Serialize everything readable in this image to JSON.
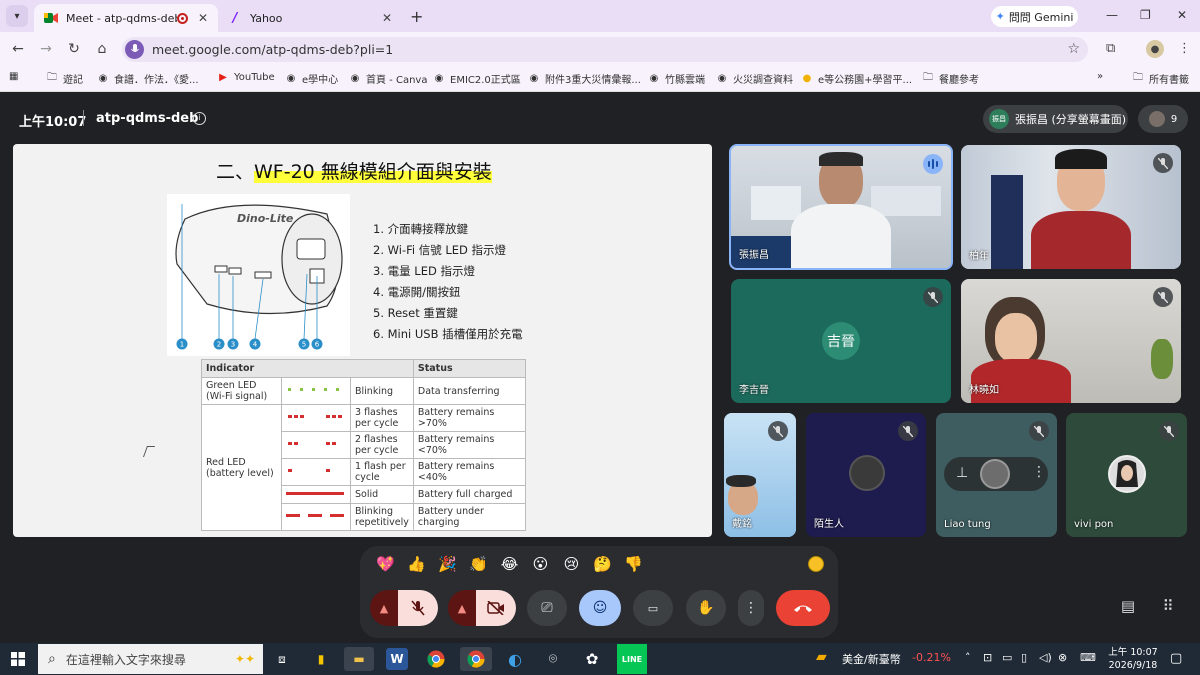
{
  "browser": {
    "tabs": [
      {
        "title": "Meet - atp-qdms-deb",
        "active": true
      },
      {
        "title": "Yahoo",
        "active": false
      }
    ],
    "gemini_label": "問問 Gemini",
    "url": "meet.google.com/atp-qdms-deb?pli=1",
    "bookmarks": [
      "遊記",
      "食譜．作法．《愛...",
      "YouTube",
      "e學中心",
      "首頁 - Canva",
      "EMIC2.0正式區",
      "附件3重大災情彙報...",
      "竹縣雲端",
      "火災調查資料",
      "e等公務園+學習平...",
      "餐廳參考"
    ],
    "all_bookmarks": "所有書籤"
  },
  "meet": {
    "time": "上午10:07",
    "meeting_code": "atp-qdms-deb",
    "presenter_chip": "張振昌 (分享螢幕畫面)",
    "presenter_initials": "振昌",
    "participant_count": "9",
    "slide": {
      "title_prefix": "二、",
      "title_highlight": "WF-20 無線模組介面與安裝",
      "device_brand": "Dino-Lite",
      "callouts": [
        "1",
        "2",
        "3",
        "4",
        "5",
        "6"
      ],
      "steps": [
        "1.  介面轉接釋放鍵",
        "2.  Wi-Fi 信號 LED 指示燈",
        "3.  電量 LED 指示燈",
        "4.  電源開/關按鈕",
        "5.  Reset 重置鍵",
        "6.  Mini USB 插槽僅用於充電"
      ],
      "table": {
        "headers": [
          "Indicator",
          "Status"
        ],
        "green_led": "Green LED (Wi-Fi signal)",
        "red_led": "Red LED (battery level)",
        "rows": [
          {
            "pattern": "Blinking",
            "status": "Data transferring"
          },
          {
            "pattern": "3 flashes per cycle",
            "status": "Battery remains >70%"
          },
          {
            "pattern": "2 flashes per cycle",
            "status": "Battery remains <70%"
          },
          {
            "pattern": "1 flash per cycle",
            "status": "Battery remains <40%"
          },
          {
            "pattern": "Solid",
            "status": "Battery full charged"
          },
          {
            "pattern": "Blinking repetitively",
            "status": "Battery under charging"
          }
        ]
      }
    },
    "participants": [
      {
        "name": "張振昌",
        "speaking": true
      },
      {
        "name": "柏年",
        "muted": true
      },
      {
        "name": "李吉晉",
        "muted": true,
        "initials": "吉晉"
      },
      {
        "name": "林曉如",
        "muted": true
      },
      {
        "name": "戴銘",
        "muted": true
      },
      {
        "name": "陌生人",
        "muted": true
      },
      {
        "name": "Liao tung",
        "muted": true
      },
      {
        "name": "vivi pon",
        "muted": true
      }
    ],
    "reactions": [
      "💖",
      "👍",
      "🎉",
      "👏",
      "😂",
      "😮",
      "😢",
      "🤔",
      "👎"
    ]
  },
  "taskbar": {
    "search_placeholder": "在這裡輸入文字來搜尋",
    "ticker_label": "美金/新臺幣",
    "ticker_value": "-0.21%",
    "clock_time": "上午 10:07",
    "clock_date": "2026/9/18"
  },
  "colors": {
    "tab_strip": "#e9def6",
    "meet_bg": "#202124",
    "end_call": "#ea4335",
    "mic_off_btn": "#f9dedc",
    "highlight": "#ffff3a"
  }
}
